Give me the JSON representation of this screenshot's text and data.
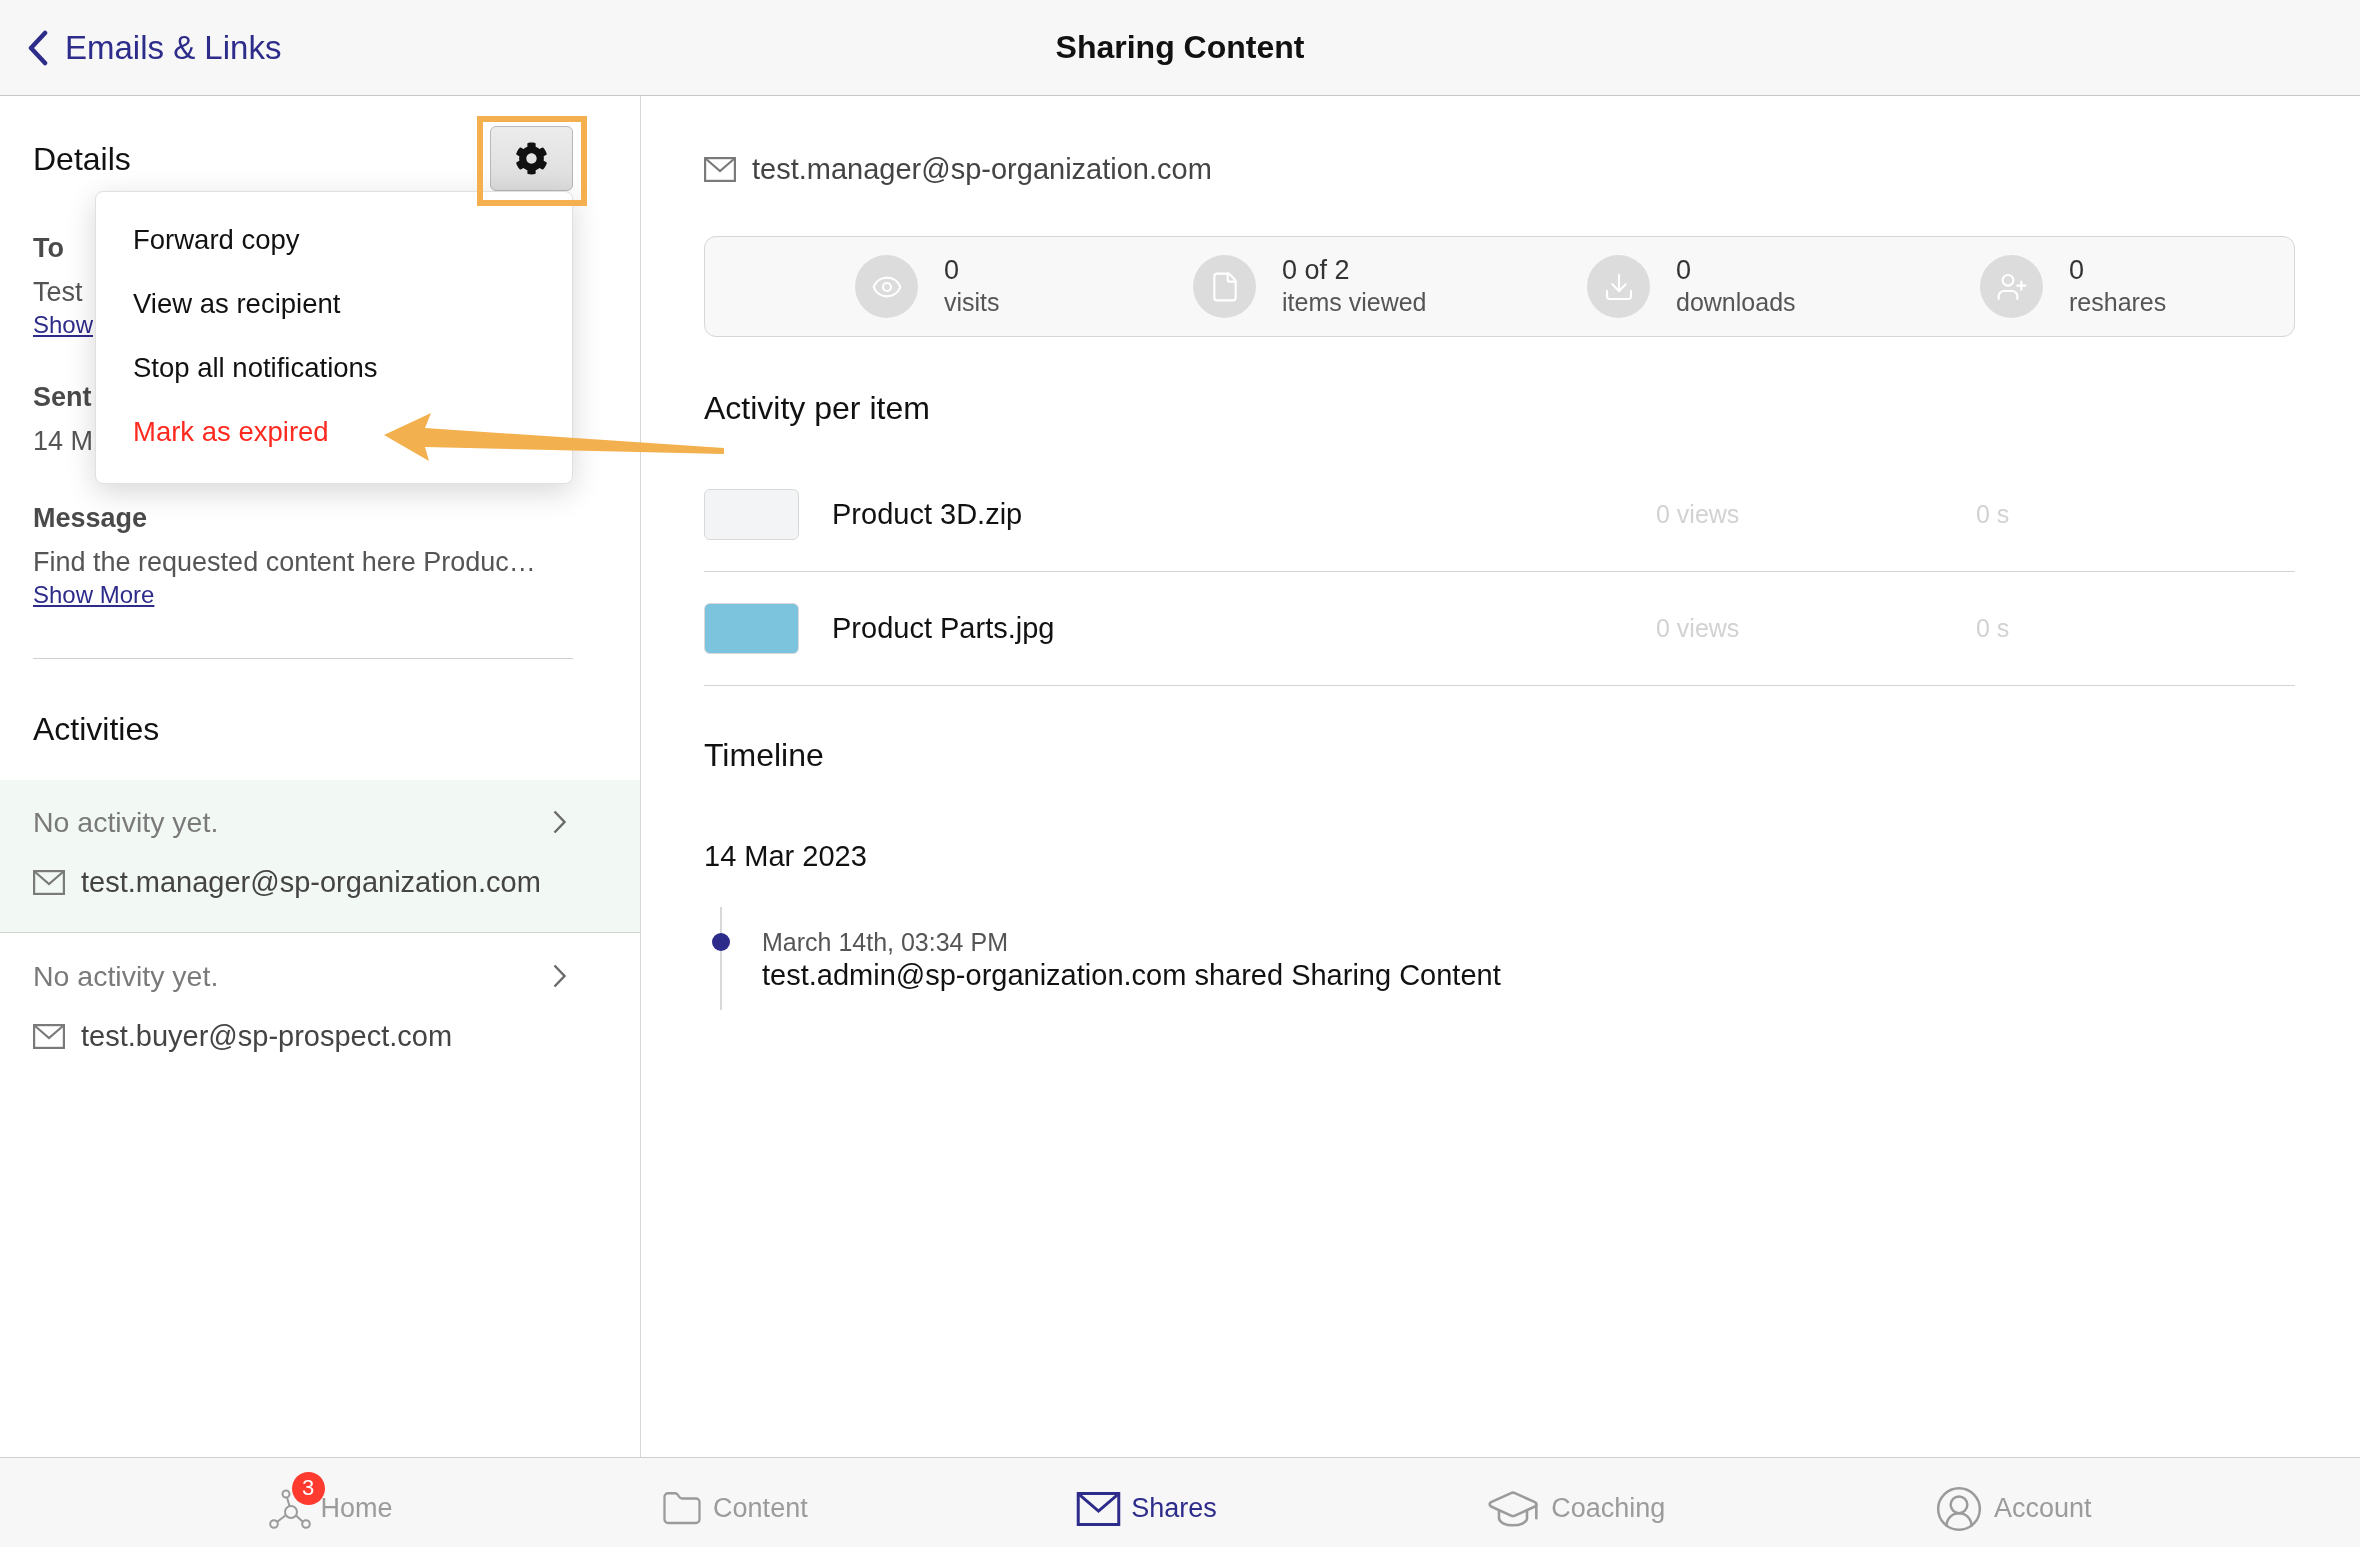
{
  "header": {
    "back_label": "Emails & Links",
    "title": "Sharing Content"
  },
  "details": {
    "title": "Details",
    "fields": [
      {
        "label": "To",
        "value": "Test",
        "link": "Show"
      },
      {
        "label": "Sent",
        "value": "14 M"
      },
      {
        "label": "Message",
        "value": "Find the requested content here Produc…",
        "link": "Show More"
      }
    ]
  },
  "settings_button": {
    "highlighted": true
  },
  "settings_menu": {
    "open": true,
    "items": [
      {
        "label": "Forward copy",
        "kind": "default",
        "callout_arrow": false
      },
      {
        "label": "View as recipient",
        "kind": "default",
        "callout_arrow": false
      },
      {
        "label": "Stop all notifications",
        "kind": "default",
        "callout_arrow": false
      },
      {
        "label": "Mark as expired",
        "kind": "destructive",
        "callout_arrow": true
      }
    ]
  },
  "activities": {
    "title": "Activities",
    "items": [
      {
        "status": "No activity yet.",
        "email": "test.manager@sp-organization.com",
        "selected": true
      },
      {
        "status": "No activity yet.",
        "email": "test.buyer@sp-prospect.com",
        "selected": false
      }
    ]
  },
  "recipient": {
    "email": "test.manager@sp-organization.com"
  },
  "stats": [
    {
      "kind": "visits",
      "value": "0",
      "label": "visits"
    },
    {
      "kind": "items",
      "value": "0 of 2",
      "label": "items viewed"
    },
    {
      "kind": "downloads",
      "value": "0",
      "label": "downloads"
    },
    {
      "kind": "reshares",
      "value": "0",
      "label": "reshares"
    }
  ],
  "activity_per_item": {
    "title": "Activity per item",
    "items": [
      {
        "name": "Product 3D.zip",
        "views": "0 views",
        "duration": "0 s",
        "color": "#f3f4f6"
      },
      {
        "name": "Product Parts.jpg",
        "views": "0 views",
        "duration": "0 s",
        "color": "#7cc3de"
      }
    ]
  },
  "timeline": {
    "title": "Timeline",
    "days": [
      {
        "date": "14 Mar 2023",
        "events": [
          {
            "time": "March 14th, 03:34 PM",
            "text": "test.admin@sp-organization.com shared Sharing Content"
          }
        ]
      }
    ]
  },
  "tabs": [
    {
      "label": "Home",
      "kind": "home",
      "selected": false,
      "badge": "3"
    },
    {
      "label": "Content",
      "kind": "content",
      "selected": false
    },
    {
      "label": "Shares",
      "kind": "shares",
      "selected": true
    },
    {
      "label": "Coaching",
      "kind": "coaching",
      "selected": false
    },
    {
      "label": "Account",
      "kind": "account",
      "selected": false
    }
  ]
}
